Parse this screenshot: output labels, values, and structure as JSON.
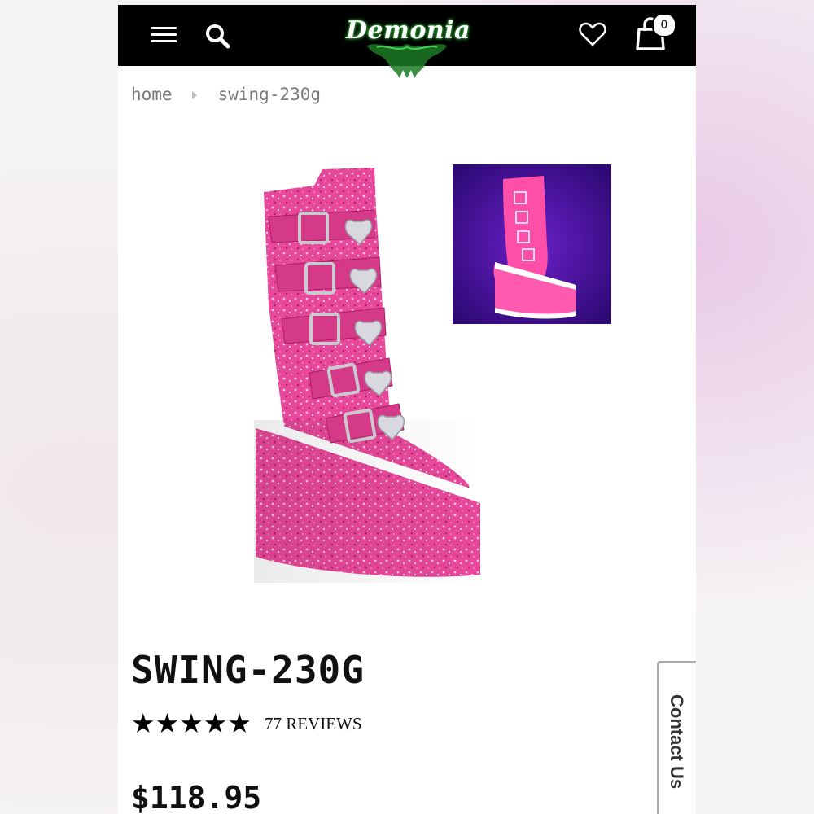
{
  "brand": {
    "logo_text": "Demonia",
    "accent": "#3fd14a"
  },
  "header": {
    "menu_icon": "hamburger-menu-icon",
    "search_icon": "search-icon",
    "wishlist_icon": "heart-icon",
    "cart_icon": "shopping-bag-icon",
    "cart_count": "0"
  },
  "breadcrumb": {
    "items": [
      "home",
      "swing-230g"
    ]
  },
  "product": {
    "title": "SWING-230G",
    "rating": {
      "stars": 5,
      "max": 5,
      "reviews_label": "77 REVIEWS"
    },
    "price": "$118.95",
    "main_image": "pink glitter platform boot",
    "thumbnail": "pink glitter boot under UV light",
    "color": "#e8489a"
  },
  "contact_tab": {
    "label": "Contact Us"
  }
}
